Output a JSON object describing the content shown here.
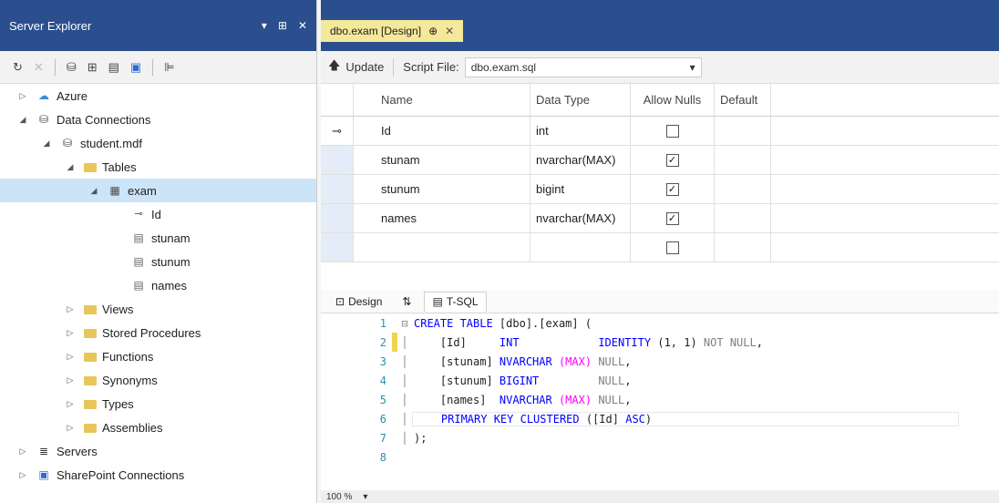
{
  "server_explorer": {
    "title": "Server Explorer",
    "controls": [
      "▾",
      "⊞",
      "✕"
    ],
    "tree": [
      {
        "label": "Azure",
        "level": 0,
        "expanded": false,
        "icon": "cloud-icon"
      },
      {
        "label": "Data Connections",
        "level": 0,
        "expanded": true,
        "icon": "data-connections-icon"
      },
      {
        "label": "student.mdf",
        "level": 1,
        "expanded": true,
        "icon": "database-icon"
      },
      {
        "label": "Tables",
        "level": 2,
        "expanded": true,
        "icon": "folder-icon"
      },
      {
        "label": "exam",
        "level": 3,
        "expanded": true,
        "icon": "table-icon",
        "selected": true
      },
      {
        "label": "Id",
        "level": 4,
        "icon": "key-icon"
      },
      {
        "label": "stunam",
        "level": 4,
        "icon": "column-icon"
      },
      {
        "label": "stunum",
        "level": 4,
        "icon": "column-icon"
      },
      {
        "label": "names",
        "level": 4,
        "icon": "column-icon"
      },
      {
        "label": "Views",
        "level": 2,
        "expanded": false,
        "icon": "folder-icon"
      },
      {
        "label": "Stored Procedures",
        "level": 2,
        "expanded": false,
        "icon": "folder-icon"
      },
      {
        "label": "Functions",
        "level": 2,
        "expanded": false,
        "icon": "folder-icon"
      },
      {
        "label": "Synonyms",
        "level": 2,
        "expanded": false,
        "icon": "folder-icon"
      },
      {
        "label": "Types",
        "level": 2,
        "expanded": false,
        "icon": "folder-icon"
      },
      {
        "label": "Assemblies",
        "level": 2,
        "expanded": false,
        "icon": "folder-icon"
      },
      {
        "label": "Servers",
        "level": 0,
        "expanded": false,
        "icon": "server-icon"
      },
      {
        "label": "SharePoint Connections",
        "level": 0,
        "expanded": false,
        "icon": "sharepoint-icon"
      }
    ]
  },
  "editor": {
    "tab_label": "dbo.exam [Design]",
    "tab_pin": "⊕",
    "tab_close": "✕",
    "toolbar": {
      "update_label": "Update",
      "script_file_label": "Script File:",
      "script_file_value": "dbo.exam.sql"
    },
    "grid": {
      "columns": [
        "Name",
        "Data Type",
        "Allow Nulls",
        "Default"
      ],
      "rows": [
        {
          "name": "Id",
          "type": "int",
          "nulls": false,
          "pk": true
        },
        {
          "name": "stunam",
          "type": "nvarchar(MAX)",
          "nulls": true
        },
        {
          "name": "stunum",
          "type": "bigint",
          "nulls": true
        },
        {
          "name": "names",
          "type": "nvarchar(MAX)",
          "nulls": true
        },
        {
          "name": "",
          "type": "",
          "nulls": false
        }
      ]
    },
    "bottom_tabs": [
      "Design",
      "T-SQL"
    ],
    "bottom_tab_swap": "⇅",
    "sql_lines": [
      {
        "n": "1",
        "parts": [
          [
            "kw",
            "CREATE TABLE "
          ],
          [
            "plain",
            "[dbo].[exam] ("
          ]
        ]
      },
      {
        "n": "2",
        "parts": [
          [
            "plain",
            "    [Id]     "
          ],
          [
            "kw",
            "INT"
          ],
          [
            "plain",
            "            "
          ],
          [
            "kw",
            "IDENTITY "
          ],
          [
            "plain",
            "(1, 1) "
          ],
          [
            "gray",
            "NOT NULL"
          ],
          [
            "plain",
            ","
          ]
        ]
      },
      {
        "n": "3",
        "parts": [
          [
            "plain",
            "    [stunam] "
          ],
          [
            "kw",
            "NVARCHAR "
          ],
          [
            "fn",
            "(MAX)"
          ],
          [
            "plain",
            " "
          ],
          [
            "gray",
            "NULL"
          ],
          [
            "plain",
            ","
          ]
        ]
      },
      {
        "n": "4",
        "parts": [
          [
            "plain",
            "    [stunum] "
          ],
          [
            "kw",
            "BIGINT"
          ],
          [
            "plain",
            "         "
          ],
          [
            "gray",
            "NULL"
          ],
          [
            "plain",
            ","
          ]
        ]
      },
      {
        "n": "5",
        "parts": [
          [
            "plain",
            "    [names]  "
          ],
          [
            "kw",
            "NVARCHAR "
          ],
          [
            "fn",
            "(MAX)"
          ],
          [
            "plain",
            " "
          ],
          [
            "gray",
            "NULL"
          ],
          [
            "plain",
            ","
          ]
        ]
      },
      {
        "n": "6",
        "parts": [
          [
            "plain",
            "    "
          ],
          [
            "kw",
            "PRIMARY KEY CLUSTERED "
          ],
          [
            "plain",
            "([Id] "
          ],
          [
            "kw",
            "ASC"
          ],
          [
            "plain",
            ")"
          ]
        ]
      },
      {
        "n": "7",
        "parts": [
          [
            "plain",
            ");"
          ]
        ]
      },
      {
        "n": "8",
        "parts": []
      }
    ],
    "zoom": "100 %"
  }
}
